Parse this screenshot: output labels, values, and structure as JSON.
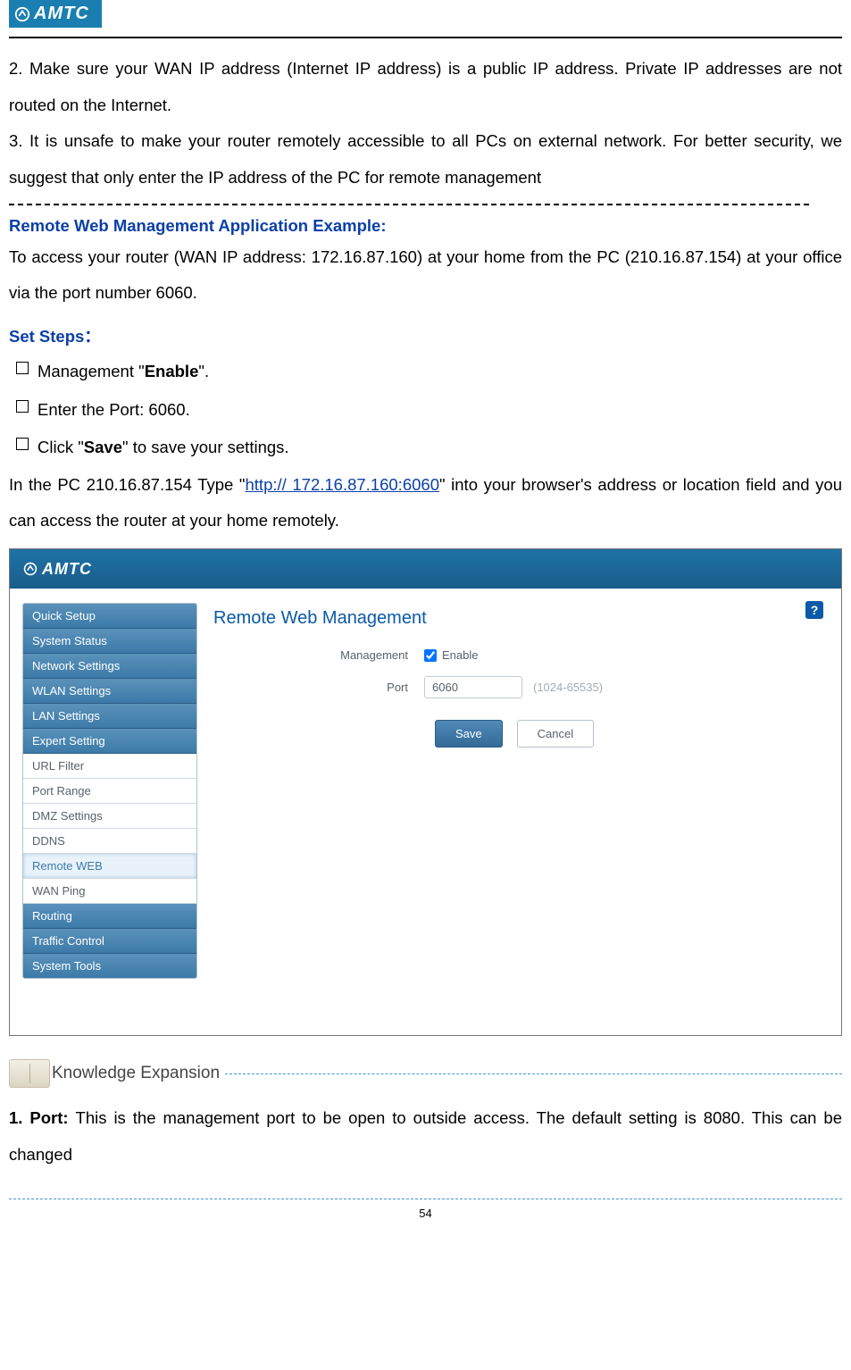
{
  "logo": {
    "text": "AMTC"
  },
  "paragraphs": {
    "p2": "2. Make sure your WAN IP address (Internet IP address) is a public IP address. Private IP addresses are not routed on the Internet.",
    "p3": "3. It is unsafe to make your router remotely accessible to all PCs on external network. For better security, we suggest that only enter the IP address of the PC for remote management"
  },
  "example_heading": "Remote Web Management Application Example:",
  "example_text": "To access your router (WAN IP address: 172.16.87.160) at your home from the PC (210.16.87.154) at your office via the port number 6060.",
  "set_steps_label": "Set Steps：",
  "steps": {
    "s1a": "Management \"",
    "s1b": "Enable",
    "s1c": "\".",
    "s2": "Enter the Port: 6060.",
    "s3a": "Click \"",
    "s3b": "Save",
    "s3c": "\" to save your settings."
  },
  "after_steps": {
    "pre": "In the PC 210.16.87.154 Type \"",
    "link": "http:// 172.16.87.160:6060",
    "post": "\" into your browser's address or location field and you can access the router at your home remotely."
  },
  "screenshot": {
    "nav": {
      "quick_setup": "Quick Setup",
      "system_status": "System Status",
      "network_settings": "Network Settings",
      "wlan_settings": "WLAN Settings",
      "lan_settings": "LAN Settings",
      "expert_setting": "Expert Setting",
      "url_filter": "URL Filter",
      "port_range": "Port Range",
      "dmz_settings": "DMZ Settings",
      "ddns": "DDNS",
      "remote_web": "Remote WEB",
      "wan_ping": "WAN Ping",
      "routing": "Routing",
      "traffic_control": "Traffic Control",
      "system_tools": "System Tools"
    },
    "content": {
      "help": "?",
      "title": "Remote Web Management",
      "mgmt_label": "Management",
      "enable_label": "Enable",
      "port_label": "Port",
      "port_value": "6060",
      "port_hint": "(1024-65535)",
      "save": "Save",
      "cancel": "Cancel"
    }
  },
  "knowledge": {
    "label": "Knowledge Expansion",
    "port_bold": "1. Port: ",
    "port_text": "This is the management port to be open to outside access. The default setting is 8080. This can be changed"
  },
  "page_number": "54"
}
